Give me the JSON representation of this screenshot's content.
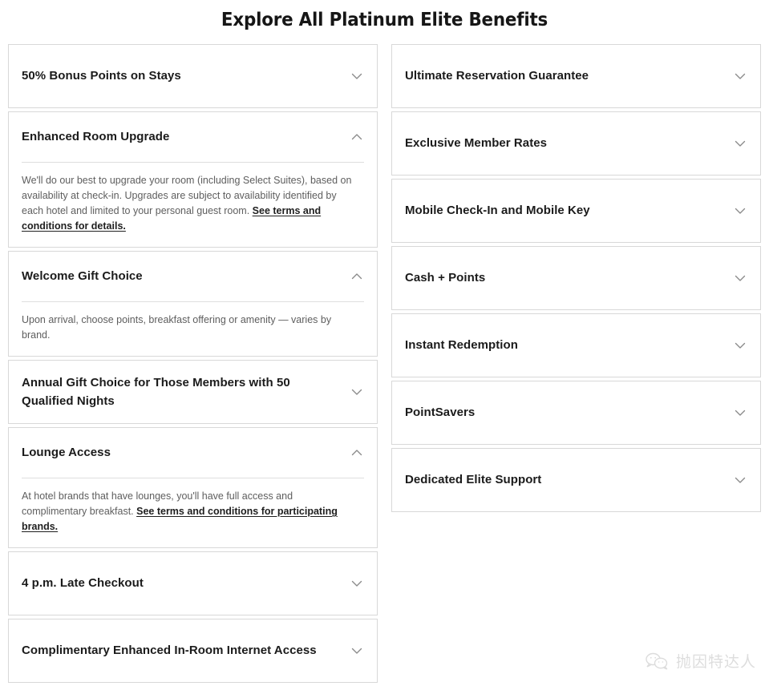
{
  "page": {
    "title": "Explore All Platinum Elite Benefits"
  },
  "icons": {
    "chevron_down": "chevron-down-icon",
    "chevron_up": "chevron-up-icon"
  },
  "left_column": [
    {
      "title": "50% Bonus Points on Stays",
      "expanded": false,
      "chevron": "chevron-down-icon",
      "body": ""
    },
    {
      "title": "Enhanced Room Upgrade",
      "expanded": true,
      "chevron": "chevron-up-icon",
      "body_pre": "We'll do our best to upgrade your room (including Select Suites), based on availability at check-in. Upgrades are subject to availability identified by each hotel and limited to your personal guest room. ",
      "body_link": "See terms and conditions for details.",
      "body_post": ""
    },
    {
      "title": "Welcome Gift Choice",
      "expanded": true,
      "chevron": "chevron-up-icon",
      "body_pre": "Upon arrival, choose points, breakfast offering or amenity — varies by brand.",
      "body_link": "",
      "body_post": ""
    },
    {
      "title": "Annual Gift Choice for Those Members with 50 Qualified Nights",
      "expanded": false,
      "chevron": "chevron-down-icon",
      "body": ""
    },
    {
      "title": "Lounge Access",
      "expanded": true,
      "chevron": "chevron-up-icon",
      "body_pre": "At hotel brands that have lounges, you'll have full access and complimentary breakfast. ",
      "body_link": "See terms and conditions for participating brands.",
      "body_post": ""
    },
    {
      "title": "4 p.m. Late Checkout",
      "expanded": false,
      "chevron": "chevron-down-icon",
      "body": ""
    },
    {
      "title": "Complimentary Enhanced In-Room Internet Access",
      "expanded": false,
      "chevron": "chevron-down-icon",
      "body": ""
    }
  ],
  "right_column": [
    {
      "title": "Ultimate Reservation Guarantee",
      "expanded": false,
      "chevron": "chevron-down-icon"
    },
    {
      "title": "Exclusive Member Rates",
      "expanded": false,
      "chevron": "chevron-down-icon"
    },
    {
      "title": "Mobile Check-In and Mobile Key",
      "expanded": false,
      "chevron": "chevron-down-icon"
    },
    {
      "title": "Cash + Points",
      "expanded": false,
      "chevron": "chevron-down-icon"
    },
    {
      "title": "Instant Redemption",
      "expanded": false,
      "chevron": "chevron-down-icon"
    },
    {
      "title": "PointSavers",
      "trademark": "™",
      "expanded": false,
      "chevron": "chevron-down-icon"
    },
    {
      "title": "Dedicated Elite Support",
      "expanded": false,
      "chevron": "chevron-down-icon"
    }
  ],
  "watermark": {
    "icon": "wechat-icon",
    "text": "抛因特达人"
  },
  "colors": {
    "title_text": "#161616",
    "header_text": "#1b1b1b",
    "body_text": "#5e5e5e",
    "card_border": "#d8d8d8",
    "divider": "#dedede",
    "chevron": "#8a8a8a",
    "background": "#ffffff"
  }
}
